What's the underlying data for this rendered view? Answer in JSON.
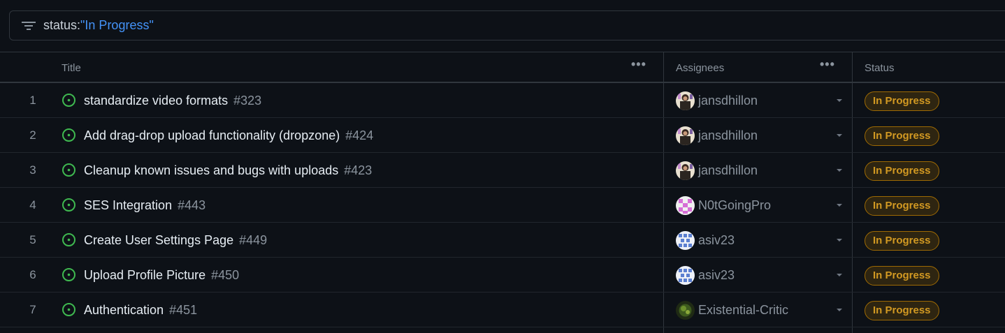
{
  "filter": {
    "key": "status:",
    "value": "\"In Progress\""
  },
  "columns": {
    "title": "Title",
    "assignees": "Assignees",
    "status": "Status",
    "menu": "•••"
  },
  "rows": [
    {
      "num": "1",
      "title": "standardize video formats",
      "issue": "#323",
      "assignee": "jansdhillon",
      "avatar": "photo-a",
      "status": "In Progress"
    },
    {
      "num": "2",
      "title": "Add drag-drop upload functionality (dropzone)",
      "issue": "#424",
      "assignee": "jansdhillon",
      "avatar": "photo-a",
      "status": "In Progress"
    },
    {
      "num": "3",
      "title": "Cleanup known issues and bugs with uploads",
      "issue": "#423",
      "assignee": "jansdhillon",
      "avatar": "photo-a",
      "status": "In Progress"
    },
    {
      "num": "4",
      "title": "SES Integration",
      "issue": "#443",
      "assignee": "N0tGoingPro",
      "avatar": "identicon-pink",
      "status": "In Progress"
    },
    {
      "num": "5",
      "title": "Create User Settings Page",
      "issue": "#449",
      "assignee": "asiv23",
      "avatar": "identicon-blue",
      "status": "In Progress"
    },
    {
      "num": "6",
      "title": "Upload Profile Picture",
      "issue": "#450",
      "assignee": "asiv23",
      "avatar": "identicon-blue",
      "status": "In Progress"
    },
    {
      "num": "7",
      "title": "Authentication",
      "issue": "#451",
      "assignee": "Existential-Critic",
      "avatar": "photo-green",
      "status": "In Progress"
    }
  ],
  "colors": {
    "open_issue": "#3fb950",
    "status_fg": "#d29922",
    "status_border": "#9e6a03",
    "link": "#4493f8"
  }
}
